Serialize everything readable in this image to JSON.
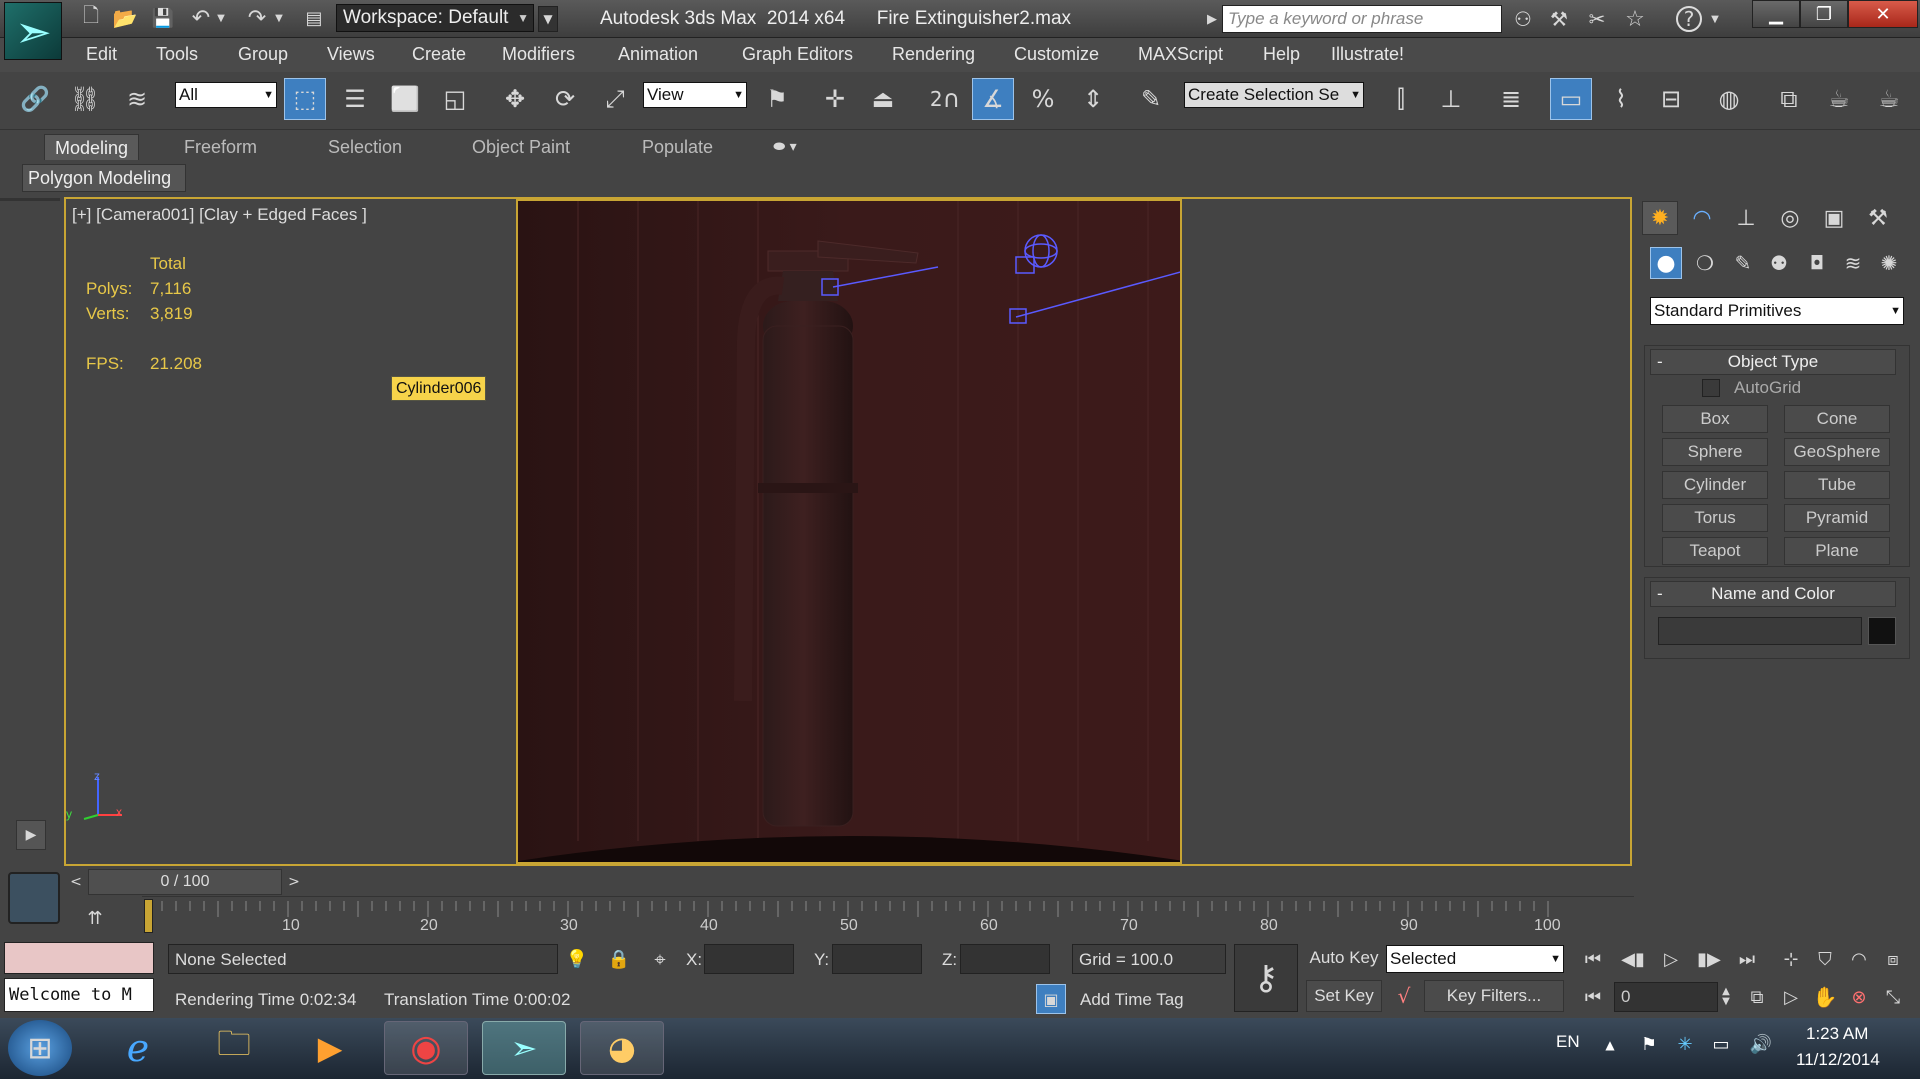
{
  "titlebar": {
    "workspace": "Workspace: Default",
    "app_title": "Autodesk 3ds Max  2014 x64      Fire Extinguisher2.max",
    "search_placeholder": "Type a keyword or phrase"
  },
  "menu": [
    "Edit",
    "Tools",
    "Group",
    "Views",
    "Create",
    "Modifiers",
    "Animation",
    "Graph Editors",
    "Rendering",
    "Customize",
    "MAXScript",
    "Help",
    "Illustrate!"
  ],
  "toolbar": {
    "filter": "All",
    "ref_coord": "View",
    "snap_2": "2",
    "percent": "%",
    "selection_set": "Create Selection Se"
  },
  "ribbon": {
    "tabs": [
      "Modeling",
      "Freeform",
      "Selection",
      "Object Paint",
      "Populate"
    ],
    "panel": "Polygon Modeling"
  },
  "viewport": {
    "label": "[+] [Camera001] [Clay + Edged Faces ]",
    "total": "Total",
    "polys_label": "Polys:",
    "polys": "7,116",
    "verts_label": "Verts:",
    "verts": "3,819",
    "fps_label": "FPS:",
    "fps": "21.208",
    "tooltip": "Cylinder006",
    "axis": {
      "z": "z",
      "y": "y",
      "x": "x"
    }
  },
  "command_panel": {
    "category": "Standard Primitives",
    "object_type": "Object Type",
    "autogrid": "AutoGrid",
    "buttons": [
      "Box",
      "Cone",
      "Sphere",
      "GeoSphere",
      "Cylinder",
      "Tube",
      "Torus",
      "Pyramid",
      "Teapot",
      "Plane"
    ],
    "name_and_color": "Name and Color",
    "object_color": "#111111"
  },
  "timeline": {
    "frame": "0 / 100",
    "ticks": [
      "10",
      "20",
      "30",
      "40",
      "50",
      "60",
      "70",
      "80",
      "90",
      "100"
    ]
  },
  "status": {
    "listener": "Welcome to M",
    "selection": "None Selected",
    "x": "X:",
    "y": "Y:",
    "z": "Z:",
    "grid": "Grid = 100.0",
    "rendering_time": "Rendering Time  0:02:34",
    "translation_time": "Translation Time  0:00:02",
    "add_time_tag": "Add Time Tag",
    "auto_key": "Auto Key",
    "selected": "Selected",
    "set_key": "Set Key",
    "key_filters": "Key Filters...",
    "frame_field": "0"
  },
  "taskbar": {
    "lang": "EN",
    "time": "1:23 AM",
    "date": "11/12/2014"
  }
}
